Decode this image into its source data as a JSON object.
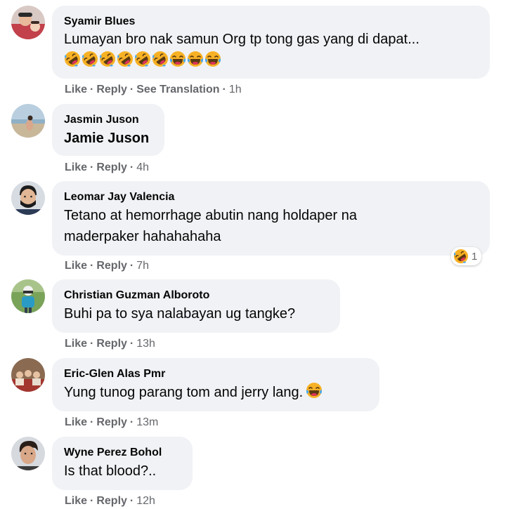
{
  "actions": {
    "like": "Like",
    "reply": "Reply",
    "see_translation": "See Translation"
  },
  "comments": [
    {
      "author": "Syamir Blues",
      "text": "Lumayan bro nak samun Org tp tong gas yang di dapat...",
      "emoji_line": [
        "rolling-on-floor-laughing-icon",
        "rolling-on-floor-laughing-icon",
        "rolling-on-floor-laughing-icon",
        "rolling-on-floor-laughing-icon",
        "rolling-on-floor-laughing-icon",
        "rolling-on-floor-laughing-icon",
        "tears-of-joy-icon",
        "tears-of-joy-icon",
        "tears-of-joy-icon"
      ],
      "time": "1h"
    },
    {
      "author": "Jasmin Juson",
      "text": "Jamie Juson",
      "time": "4h"
    },
    {
      "author": "Leomar Jay Valencia",
      "text_lines": [
        "Tetano at hemorrhage abutin nang holdaper na",
        "maderpaker hahahahaha"
      ],
      "reaction": {
        "icon": "haha-reaction-icon",
        "count": "1"
      },
      "time": "7h"
    },
    {
      "author": "Christian Guzman Alboroto",
      "text": "Buhi pa to sya nalabayan ug tangke?",
      "time": "13h"
    },
    {
      "author": "Eric-Glen Alas Pmr",
      "text": "Yung tunog parang tom and jerry lang.",
      "trailing_emoji": "tears-of-joy-icon",
      "time": "13m"
    },
    {
      "author": "Wyne Perez Bohol",
      "text": "Is that blood?..",
      "time": "12h"
    }
  ],
  "colors": {
    "bubble": "#f0f2f5",
    "meta": "#65676b",
    "text": "#050505",
    "emoji_yellow": "#f7b125"
  }
}
